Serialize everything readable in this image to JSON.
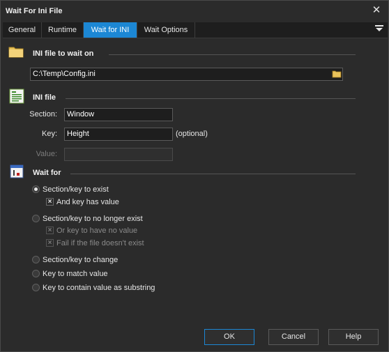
{
  "window": {
    "title": "Wait For Ini File"
  },
  "tabs": [
    {
      "label": "General"
    },
    {
      "label": "Runtime"
    },
    {
      "label": "Wait for INI"
    },
    {
      "label": "Wait Options"
    }
  ],
  "active_tab": "Wait for INI",
  "sections": {
    "ini_file_to_wait_on": {
      "title": "INI file to wait on",
      "path_value": "C:\\Temp\\Config.ini"
    },
    "ini_file": {
      "title": "INI file",
      "section_label": "Section:",
      "section_value": "Window",
      "key_label": "Key:",
      "key_value": "Height",
      "key_hint": "(optional)",
      "value_label": "Value:",
      "value_value": ""
    },
    "wait_for": {
      "title": "Wait for",
      "options": [
        {
          "label": "Section/key to exist",
          "checked": true
        },
        {
          "label": "Section/key to no longer exist",
          "checked": false
        },
        {
          "label": "Section/key to change",
          "checked": false
        },
        {
          "label": "Key to match value",
          "checked": false
        },
        {
          "label": "Key to contain value as substring",
          "checked": false
        }
      ],
      "sub_options": {
        "and_key_has_value": {
          "label": "And key has value",
          "checked": true
        },
        "or_key_no_value": {
          "label": "Or key to have no value",
          "checked": true
        },
        "fail_if_missing": {
          "label": "Fail if the file doesn't exist",
          "checked": true
        }
      }
    }
  },
  "buttons": {
    "ok": "OK",
    "cancel": "Cancel",
    "help": "Help"
  },
  "colors": {
    "accent": "#1c87d4",
    "background": "#2b2b2b",
    "input_bg": "#1e1e1e"
  }
}
